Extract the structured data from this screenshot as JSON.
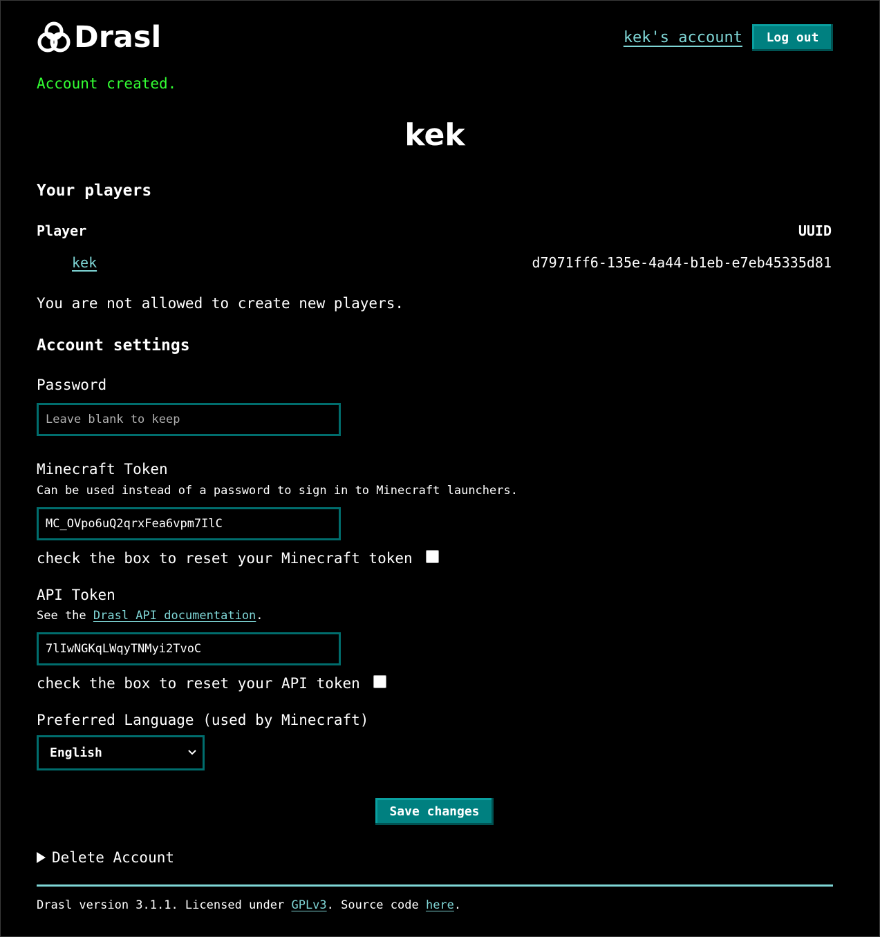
{
  "header": {
    "app_name": "Drasl",
    "account_link": "kek's account",
    "logout_label": "Log out"
  },
  "flash_message": "Account created.",
  "colors": {
    "accent": "#008080",
    "link": "#7fd6d6",
    "success": "#33ff33",
    "background": "#000000"
  },
  "page_title": "kek",
  "players": {
    "heading": "Your players",
    "columns": [
      "Player",
      "UUID"
    ],
    "rows": [
      {
        "player": "kek",
        "uuid": "d7971ff6-135e-4a44-b1eb-e7eb45335d81"
      }
    ],
    "notice": "You are not allowed to create new players."
  },
  "settings": {
    "heading": "Account settings",
    "password": {
      "label": "Password",
      "placeholder": "Leave blank to keep",
      "value": ""
    },
    "minecraft_token": {
      "label": "Minecraft Token",
      "description": "Can be used instead of a password to sign in to Minecraft launchers.",
      "value": "MC_OVpo6uQ2qrxFea6vpm7IlC",
      "reset_label": "check the box to reset your Minecraft token"
    },
    "api_token": {
      "label": "API Token",
      "description_prefix": "See the ",
      "description_link": "Drasl API documentation",
      "description_suffix": ".",
      "value": "7lIwNGKqLWqyTNMyi2TvoC",
      "reset_label": "check the box to reset your API token"
    },
    "language": {
      "label": "Preferred Language (used by Minecraft)",
      "selected": "English"
    },
    "save_label": "Save changes",
    "delete_label": "Delete Account"
  },
  "footer": {
    "prefix": "Drasl version 3.1.1. Licensed under ",
    "license_link": "GPLv3",
    "middle": ". Source code ",
    "source_link": "here",
    "suffix": "."
  }
}
